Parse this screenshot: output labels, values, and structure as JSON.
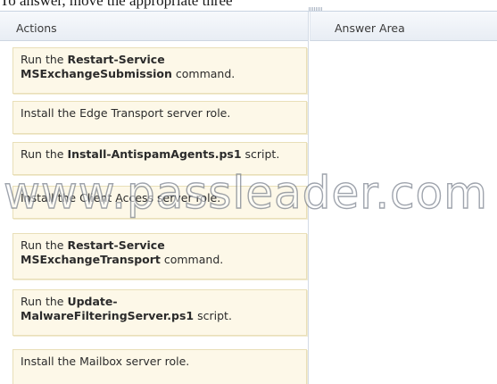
{
  "prompt_fragment": "To answer, move the appropriate three",
  "actions": {
    "header": "Actions",
    "items": [
      {
        "lines": [
          [
            {
              "t": "Run the ",
              "b": false
            },
            {
              "t": "Restart-Service",
              "b": true
            }
          ],
          [
            {
              "t": "MSExchangeSubmission",
              "b": true
            },
            {
              "t": " command.",
              "b": false
            }
          ]
        ]
      },
      {
        "lines": [
          [
            {
              "t": "Install the Edge Transport server role.",
              "b": false
            }
          ]
        ]
      },
      {
        "lines": [
          [
            {
              "t": "Run the ",
              "b": false
            },
            {
              "t": "Install-AntispamAgents.ps1",
              "b": true
            },
            {
              "t": " script.",
              "b": false
            }
          ]
        ]
      },
      {
        "lines": [
          [
            {
              "t": "Install the Client Access server role.",
              "b": false
            }
          ]
        ]
      },
      {
        "lines": [
          [
            {
              "t": "Run the ",
              "b": false
            },
            {
              "t": "Restart-Service",
              "b": true
            }
          ],
          [
            {
              "t": "MSExchangeTransport",
              "b": true
            },
            {
              "t": " command.",
              "b": false
            }
          ]
        ]
      },
      {
        "lines": [
          [
            {
              "t": "Run the ",
              "b": false
            },
            {
              "t": "Update-",
              "b": true
            }
          ],
          [
            {
              "t": "MalwareFilteringServer.ps1",
              "b": true
            },
            {
              "t": " script.",
              "b": false
            }
          ]
        ]
      },
      {
        "lines": [
          [
            {
              "t": "Install the Mailbox server role.",
              "b": false
            }
          ]
        ]
      }
    ]
  },
  "answer_area": {
    "header": "Answer Area"
  },
  "watermark": "www.passleader.com"
}
